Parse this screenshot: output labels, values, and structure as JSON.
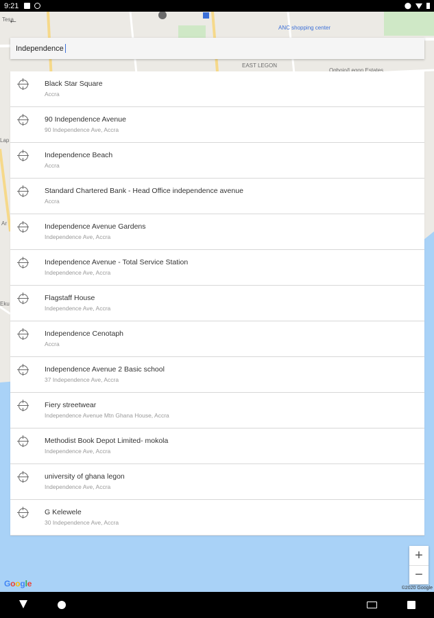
{
  "status_bar": {
    "time": "9:21"
  },
  "map": {
    "labels": {
      "top_left": "Tesa",
      "anc": "ANC shopping center",
      "east_legon": "EAST LEGON",
      "estates": "Ogbojo/Legon Estates",
      "lap": "Lap",
      "ar": "Ar",
      "eku": "Eku"
    },
    "zoom_in": "+",
    "zoom_out": "−",
    "logo": [
      "G",
      "o",
      "o",
      "g",
      "l",
      "e"
    ],
    "logo_colors": [
      "#4285f4",
      "#ea4335",
      "#fbbc05",
      "#4285f4",
      "#34a853",
      "#ea4335"
    ],
    "copyright": "©2020 Google",
    "colors": {
      "land": "#eceae5",
      "water": "#a9d2f7",
      "road": "#ffffff",
      "highway": "#f6d98a"
    }
  },
  "search": {
    "value": "Independence"
  },
  "results": [
    {
      "title": "Black Star Square",
      "subtitle": "Accra"
    },
    {
      "title": "90 Independence Avenue",
      "subtitle": "90 Independence Ave, Accra"
    },
    {
      "title": "Independence Beach",
      "subtitle": "Accra"
    },
    {
      "title": "Standard Chartered Bank - Head Office independence avenue",
      "subtitle": "Accra"
    },
    {
      "title": "Independence Avenue Gardens",
      "subtitle": "Independence Ave, Accra"
    },
    {
      "title": "Independence Avenue - Total Service Station",
      "subtitle": "Independence Ave, Accra"
    },
    {
      "title": "Flagstaff House",
      "subtitle": "Independence Ave, Accra"
    },
    {
      "title": "Independence Cenotaph",
      "subtitle": "Accra"
    },
    {
      "title": "Independence Avenue 2 Basic school",
      "subtitle": "37 Independence Ave, Accra"
    },
    {
      "title": "Fiery streetwear",
      "subtitle": "Independence Avenue Mtn Ghana House, Accra"
    },
    {
      "title": "Methodist Book Depot Limited- mokola",
      "subtitle": "Independence Ave, Accra"
    },
    {
      "title": "university of ghana legon",
      "subtitle": "Independence Ave, Accra"
    },
    {
      "title": "G Kelewele",
      "subtitle": "30 Independence Ave, Accra"
    }
  ]
}
